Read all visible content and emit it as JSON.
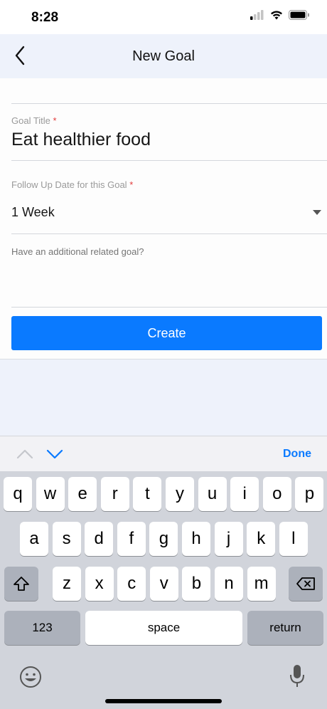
{
  "status_bar": {
    "time": "8:28"
  },
  "nav": {
    "title": "New Goal",
    "back_icon": "chevron-left-icon"
  },
  "form": {
    "goal_title": {
      "label": "Goal Title",
      "required_mark": "*",
      "value": "Eat healthier food"
    },
    "follow_up": {
      "label": "Follow Up Date for this Goal",
      "required_mark": "*",
      "value": "1 Week"
    },
    "related": {
      "placeholder": "Have an additional related goal?"
    },
    "create_label": "Create"
  },
  "accessory": {
    "done_label": "Done"
  },
  "keyboard": {
    "row1": [
      "q",
      "w",
      "e",
      "r",
      "t",
      "y",
      "u",
      "i",
      "o",
      "p"
    ],
    "row2": [
      "a",
      "s",
      "d",
      "f",
      "g",
      "h",
      "j",
      "k",
      "l"
    ],
    "row3": [
      "z",
      "x",
      "c",
      "v",
      "b",
      "n",
      "m"
    ],
    "numbers_label": "123",
    "space_label": "space",
    "return_label": "return"
  },
  "colors": {
    "accent": "#0a7aff",
    "required": "#e23b3b",
    "keyboard_bg": "#d1d4db"
  }
}
